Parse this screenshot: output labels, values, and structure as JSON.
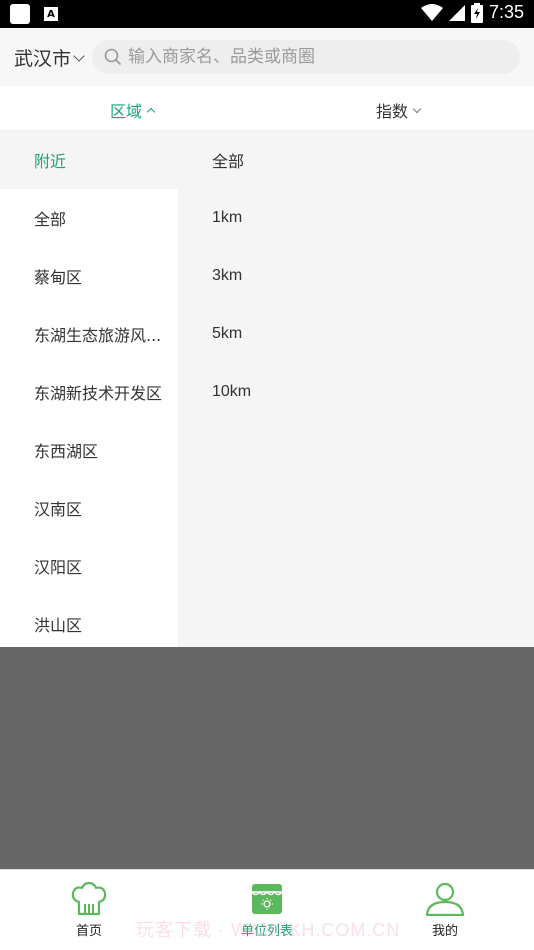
{
  "status_bar": {
    "time": "7:35",
    "a_icon_label": "A"
  },
  "header": {
    "city": "武汉市",
    "search_placeholder": "输入商家名、品类或商圈"
  },
  "filters": {
    "area_label": "区域",
    "index_label": "指数"
  },
  "areas": [
    {
      "label": "附近",
      "active": true
    },
    {
      "label": "全部"
    },
    {
      "label": "蔡甸区"
    },
    {
      "label": "东湖生态旅游风..."
    },
    {
      "label": "东湖新技术开发区"
    },
    {
      "label": "东西湖区"
    },
    {
      "label": "汉南区"
    },
    {
      "label": "汉阳区"
    },
    {
      "label": "洪山区"
    }
  ],
  "distances": [
    "全部",
    "1km",
    "3km",
    "5km",
    "10km"
  ],
  "bottom_nav": {
    "home": "首页",
    "list": "单位列表",
    "me": "我的"
  },
  "colors": {
    "accent": "#1aa37a",
    "overlay": "#666666"
  },
  "watermark": "玩客下载 · WANKXH.COM.CN"
}
